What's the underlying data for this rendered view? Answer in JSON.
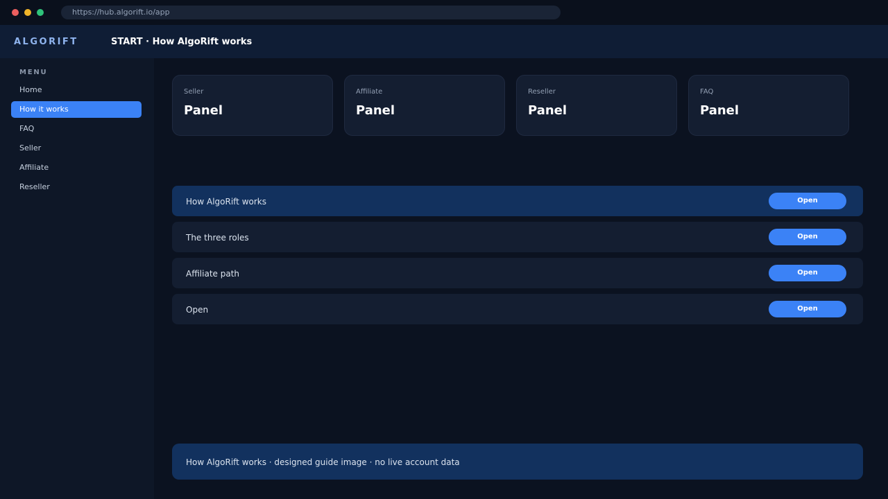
{
  "browser": {
    "url": "https://hub.algorift.io/app"
  },
  "header": {
    "brand": "ALGORIFT",
    "title": "START · How AlgoRift works"
  },
  "sidebar": {
    "section_label": "MENU",
    "items": [
      {
        "label": "Home",
        "active": false
      },
      {
        "label": "How it works",
        "active": true
      },
      {
        "label": "FAQ",
        "active": false
      },
      {
        "label": "Seller",
        "active": false
      },
      {
        "label": "Affiliate",
        "active": false
      },
      {
        "label": "Reseller",
        "active": false
      }
    ]
  },
  "cards": [
    {
      "label": "Seller",
      "value": "Panel"
    },
    {
      "label": "Affiliate",
      "value": "Panel"
    },
    {
      "label": "Reseller",
      "value": "Panel"
    },
    {
      "label": "FAQ",
      "value": "Panel"
    }
  ],
  "rows": [
    {
      "label": "How AlgoRift works",
      "button": "Open",
      "active": true
    },
    {
      "label": "The three roles",
      "button": "Open",
      "active": false
    },
    {
      "label": "Affiliate path",
      "button": "Open",
      "active": false
    },
    {
      "label": "Open",
      "button": "Open",
      "active": false
    }
  ],
  "footer": {
    "text": "How AlgoRift works · designed guide image · no live account data"
  },
  "colors": {
    "accent": "#3b82f6",
    "background": "#0b1220",
    "active_row": "#12315e"
  }
}
